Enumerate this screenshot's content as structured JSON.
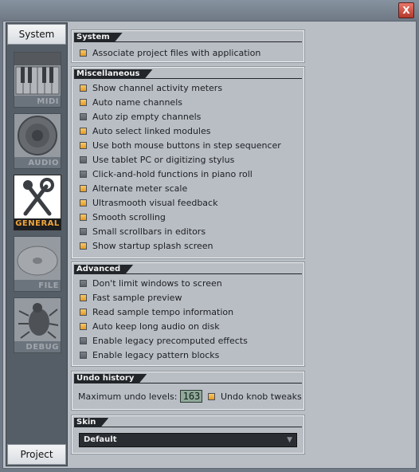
{
  "window": {
    "close_label": "X"
  },
  "sidebar": {
    "top_tab": "System",
    "bottom_tab": "Project",
    "categories": [
      {
        "label": "MIDI",
        "icon": "piano-keyboard-icon",
        "active": false
      },
      {
        "label": "AUDIO",
        "icon": "speaker-icon",
        "active": false
      },
      {
        "label": "GENERAL",
        "icon": "wrench-icon",
        "active": true
      },
      {
        "label": "FILE",
        "icon": "disc-icon",
        "active": false
      },
      {
        "label": "DEBUG",
        "icon": "bug-icon",
        "active": false
      }
    ]
  },
  "system": {
    "title": "System",
    "items": [
      {
        "label": "Associate project files with application",
        "checked": true
      }
    ]
  },
  "misc": {
    "title": "Miscellaneous",
    "items": [
      {
        "label": "Show channel activity meters",
        "checked": true
      },
      {
        "label": "Auto name channels",
        "checked": true
      },
      {
        "label": "Auto zip empty channels",
        "checked": false
      },
      {
        "label": "Auto select linked modules",
        "checked": true
      },
      {
        "label": "Use both mouse buttons in step sequencer",
        "checked": true
      },
      {
        "label": "Use tablet PC or digitizing stylus",
        "checked": false
      },
      {
        "label": "Click-and-hold functions in piano roll",
        "checked": false
      },
      {
        "label": "Alternate meter scale",
        "checked": true
      },
      {
        "label": "Ultrasmooth visual feedback",
        "checked": true
      },
      {
        "label": "Smooth scrolling",
        "checked": true
      },
      {
        "label": "Small scrollbars in editors",
        "checked": false
      },
      {
        "label": "Show startup splash screen",
        "checked": true
      }
    ]
  },
  "advanced": {
    "title": "Advanced",
    "items": [
      {
        "label": "Don't limit windows to screen",
        "checked": false
      },
      {
        "label": "Fast sample preview",
        "checked": true
      },
      {
        "label": "Read sample tempo information",
        "checked": true
      },
      {
        "label": "Auto keep long audio on disk",
        "checked": true
      },
      {
        "label": "Enable legacy precomputed effects",
        "checked": false
      },
      {
        "label": "Enable legacy pattern blocks",
        "checked": false
      }
    ]
  },
  "undo": {
    "title": "Undo history",
    "max_label": "Maximum undo levels:",
    "max_value": "163",
    "knob_label": "Undo knob tweaks",
    "knob_checked": true
  },
  "skin": {
    "title": "Skin",
    "value": "Default"
  },
  "colors": {
    "accent": "#f1a53a",
    "checkbox_on": "#f3b548",
    "panel": "#b9bec5",
    "header": "#22262a"
  }
}
